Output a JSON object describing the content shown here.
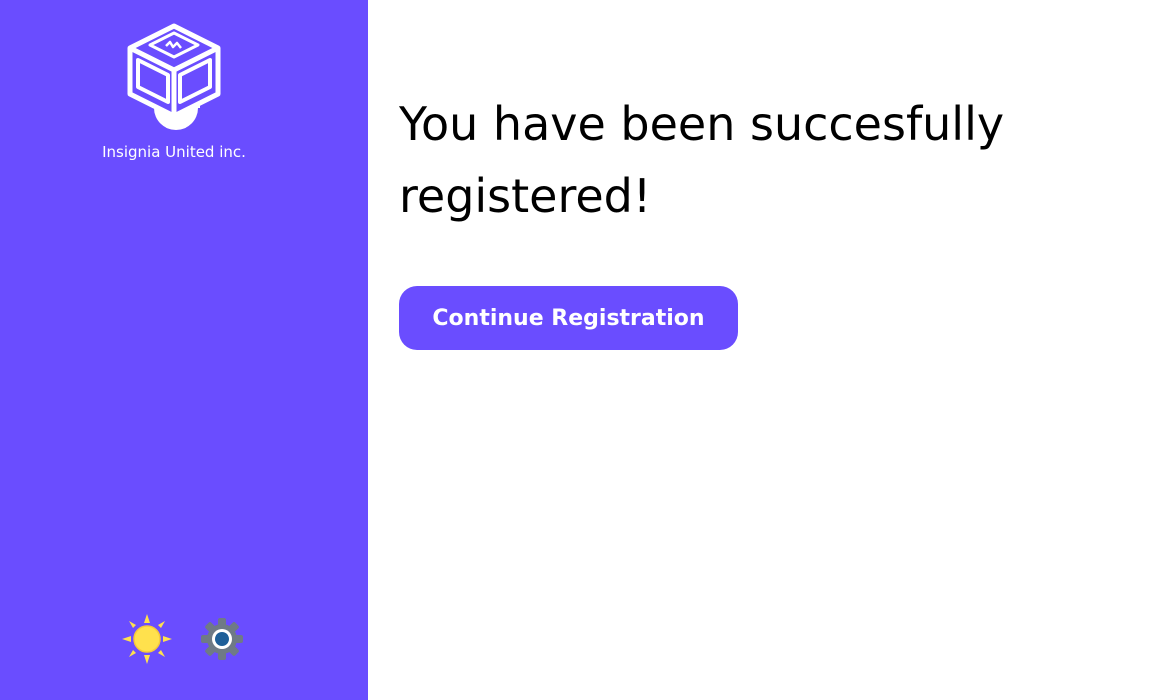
{
  "brand": {
    "company_name": "Insignia United inc.",
    "logo_icon": "box-logo-icon"
  },
  "sidebar": {
    "theme_toggle_icon": "sun-icon",
    "settings_icon": "gear-icon"
  },
  "main": {
    "message": "You have been succesfully registered!",
    "continue_label": "Continue Registration"
  },
  "colors": {
    "accent": "#6a4dff",
    "background": "#ffffff",
    "text": "#000000",
    "sun": "#ffe14d",
    "gear": "#6f7a86",
    "gear_center": "#1f5f99"
  }
}
